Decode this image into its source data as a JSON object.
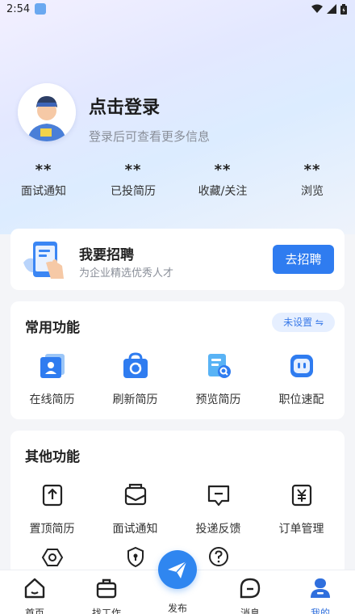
{
  "status_bar": {
    "time": "2:54"
  },
  "profile": {
    "login_title": "点击登录",
    "login_subtitle": "登录后可查看更多信息"
  },
  "stats": [
    {
      "value": "**",
      "label": "面试通知"
    },
    {
      "value": "**",
      "label": "已投简历"
    },
    {
      "value": "**",
      "label": "收藏/关注"
    },
    {
      "value": "**",
      "label": "浏览"
    }
  ],
  "recruit_card": {
    "title": "我要招聘",
    "subtitle": "为企业精选优秀人才",
    "button_label": "去招聘"
  },
  "common_functions": {
    "title": "常用功能",
    "settings_label": "未设置 ⇋",
    "items": [
      {
        "label": "在线简历",
        "icon": "online-resume-icon"
      },
      {
        "label": "刷新简历",
        "icon": "refresh-resume-icon"
      },
      {
        "label": "预览简历",
        "icon": "preview-resume-icon"
      },
      {
        "label": "职位速配",
        "icon": "job-match-icon"
      }
    ]
  },
  "other_functions": {
    "title": "其他功能",
    "items": [
      {
        "label": "置顶简历",
        "icon": "pin-resume-icon"
      },
      {
        "label": "面试通知",
        "icon": "interview-notice-icon"
      },
      {
        "label": "投递反馈",
        "icon": "delivery-feedback-icon"
      },
      {
        "label": "订单管理",
        "icon": "order-management-icon"
      }
    ],
    "partial_icons": [
      "settings-hex-icon",
      "privacy-shield-icon",
      "help-icon"
    ]
  },
  "tabbar": {
    "items": [
      {
        "label": "首页",
        "icon": "home-icon"
      },
      {
        "label": "找工作",
        "icon": "briefcase-icon"
      },
      {
        "label": "发布",
        "icon": "send-icon"
      },
      {
        "label": "消息",
        "icon": "message-icon"
      },
      {
        "label": "我的",
        "icon": "profile-icon"
      }
    ],
    "active": "我的"
  },
  "colors": {
    "accent": "#2f7cf0",
    "active_tab": "#2f6fdd"
  }
}
